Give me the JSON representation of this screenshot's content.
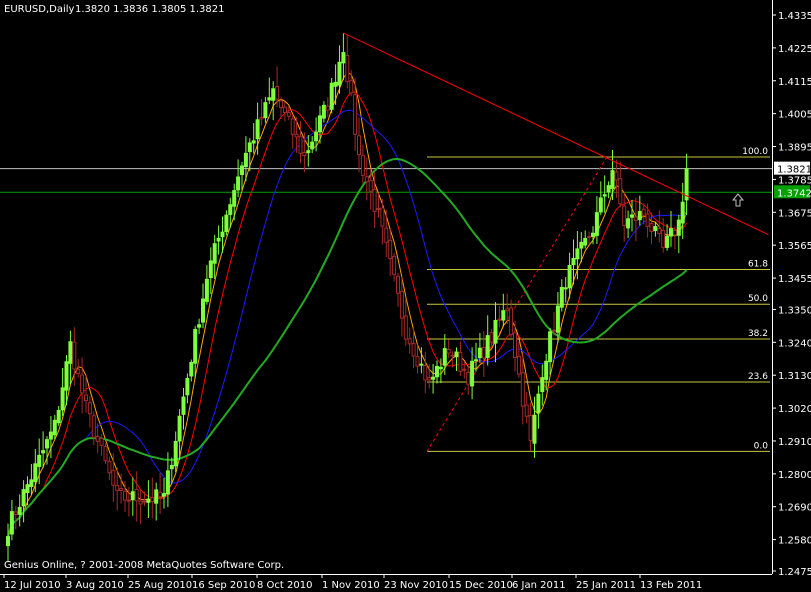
{
  "header": {
    "symbol": "EURUSD,Daily",
    "ohlc": "1.3820 1.3836 1.3805 1.3821"
  },
  "footer": {
    "copyright": "Genius Online, ? 2001-2008 MetaQuotes Software Corp."
  },
  "colors": {
    "background": "#000000",
    "bull": "#7fff3f",
    "bear": "#a52a2a",
    "ma_red": "#ff0000",
    "ma_orange": "#ffa500",
    "ma_blue": "#1a1aff",
    "ma_green": "#22aa22",
    "trendline": "#ff0000",
    "fib": "#c8c840",
    "hline_green": "#00a000",
    "hline_gray": "#c0c0c0"
  },
  "price_labels": {
    "current": "1.3821",
    "level": "1.3742"
  },
  "arrow_icon": "up-arrow-icon",
  "chart_data": {
    "type": "candlestick",
    "title": "EURUSD,Daily",
    "ylim": [
      1.2475,
      1.4335
    ],
    "y_ticks": [
      "1.4335",
      "1.4225",
      "1.4115",
      "1.4005",
      "1.3895",
      "1.3785",
      "1.3675",
      "1.3565",
      "1.3455",
      "1.3350",
      "1.3240",
      "1.3130",
      "1.3020",
      "1.2910",
      "1.2800",
      "1.2690",
      "1.2580",
      "1.2475"
    ],
    "x_ticks": [
      "12 Jul 2010",
      "3 Aug 2010",
      "25 Aug 2010",
      "16 Sep 2010",
      "8 Oct 2010",
      "1 Nov 2010",
      "23 Nov 2010",
      "15 Dec 2010",
      "6 Jan 2011",
      "25 Jan 2011",
      "13 Feb 2011"
    ],
    "anchors": [
      {
        "day": 0,
        "price": 1.262
      },
      {
        "day": 12,
        "price": 1.296
      },
      {
        "day": 16,
        "price": 1.323
      },
      {
        "day": 20,
        "price": 1.302
      },
      {
        "day": 28,
        "price": 1.272
      },
      {
        "day": 40,
        "price": 1.272
      },
      {
        "day": 51,
        "price": 1.346
      },
      {
        "day": 60,
        "price": 1.384
      },
      {
        "day": 68,
        "price": 1.408
      },
      {
        "day": 76,
        "price": 1.386
      },
      {
        "day": 82,
        "price": 1.404
      },
      {
        "day": 86,
        "price": 1.423
      },
      {
        "day": 90,
        "price": 1.386
      },
      {
        "day": 95,
        "price": 1.366
      },
      {
        "day": 102,
        "price": 1.328
      },
      {
        "day": 108,
        "price": 1.31
      },
      {
        "day": 113,
        "price": 1.322
      },
      {
        "day": 118,
        "price": 1.313
      },
      {
        "day": 124,
        "price": 1.326
      },
      {
        "day": 128,
        "price": 1.336
      },
      {
        "day": 134,
        "price": 1.29
      },
      {
        "day": 137,
        "price": 1.315
      },
      {
        "day": 143,
        "price": 1.345
      },
      {
        "day": 150,
        "price": 1.362
      },
      {
        "day": 155,
        "price": 1.382
      },
      {
        "day": 158,
        "price": 1.364
      },
      {
        "day": 163,
        "price": 1.367
      },
      {
        "day": 168,
        "price": 1.355
      },
      {
        "day": 172,
        "price": 1.364
      },
      {
        "day": 174,
        "price": 1.3821
      }
    ],
    "trendline": {
      "from": {
        "day": 86,
        "price": 1.4275
      },
      "to": {
        "day": 195,
        "price": 1.36
      }
    },
    "fib_retracement": {
      "high": 1.386,
      "low": 1.2875,
      "levels": [
        {
          "label": "100.0",
          "ratio": 1.0
        },
        {
          "label": "61.8",
          "ratio": 0.618
        },
        {
          "label": "50.0",
          "ratio": 0.5
        },
        {
          "label": "38.2",
          "ratio": 0.382
        },
        {
          "label": "23.6",
          "ratio": 0.236
        },
        {
          "label": "0.0",
          "ratio": 0.0
        }
      ]
    },
    "horizontal_lines": [
      {
        "name": "current",
        "price": 1.3821,
        "color": "#c0c0c0"
      },
      {
        "name": "level",
        "price": 1.3742,
        "color": "#00a000"
      }
    ],
    "moving_averages": [
      {
        "period": 5,
        "color": "#ffa500"
      },
      {
        "period": 10,
        "color": "#ff0000"
      },
      {
        "period": 21,
        "color": "#1a1aff"
      },
      {
        "period": 50,
        "color": "#22aa22"
      }
    ]
  }
}
